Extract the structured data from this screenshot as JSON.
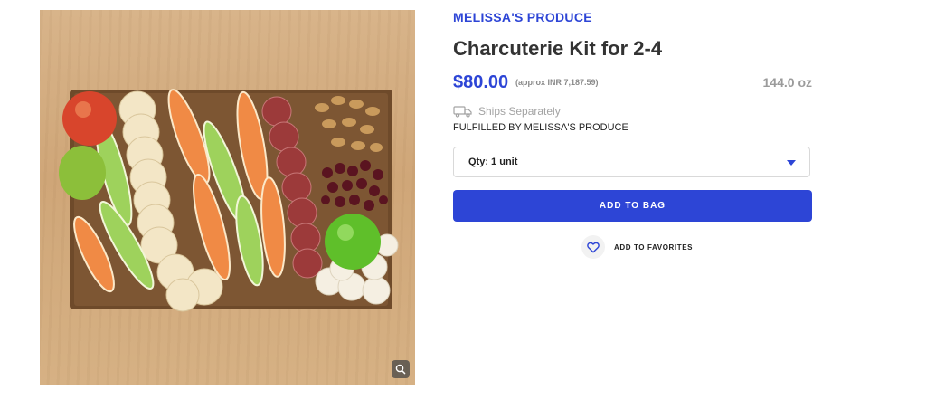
{
  "product": {
    "brand": "MELISSA'S PRODUCE",
    "title": "Charcuterie Kit for 2-4",
    "price": "$80.00",
    "price_approx": "(approx INR 7,187.59)",
    "weight": "144.0 oz",
    "shipping_note": "Ships Separately",
    "fulfilled_by": "FULFILLED BY MELISSA'S PRODUCE",
    "image_alt": "Charcuterie board with sliced apples, pears, crackers, salami, nuts, dried cranberries and cheese",
    "zoom_icon": "magnifier-icon",
    "truck_icon": "truck-icon"
  },
  "quantity": {
    "label": "Qty: 1 unit",
    "caret_icon": "caret-down-icon"
  },
  "actions": {
    "add_to_bag": "ADD TO BAG",
    "add_to_favorites": "ADD TO FAVORITES",
    "favorite_icon": "heart-icon"
  },
  "colors": {
    "accent": "#2d45d6",
    "muted": "#9b9b9b"
  }
}
